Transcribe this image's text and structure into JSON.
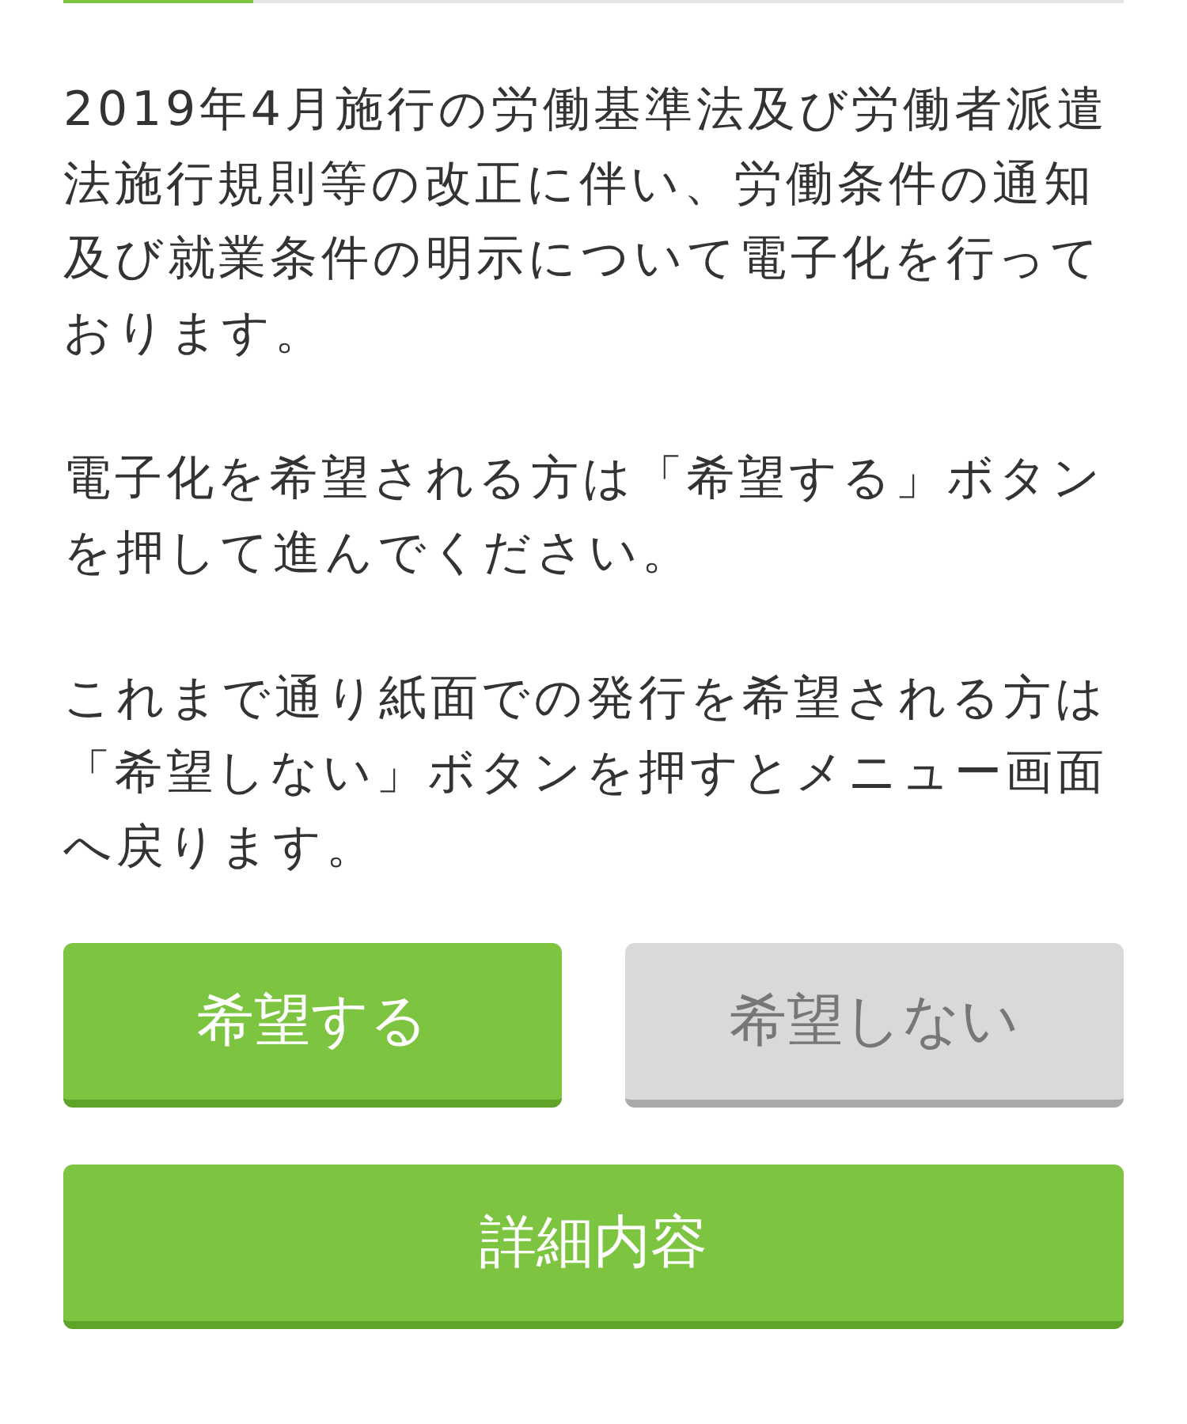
{
  "tab_bar": {
    "tabs": [
      {
        "selected": true
      },
      {
        "selected": false
      }
    ]
  },
  "paragraphs": [
    "2019年4月施行の労働基準法及び労働者派遣法施行規則等の改正に伴い、労働条件の通知及び就業条件の明示について電子化を行っております。",
    "電子化を希望される方は「希望する」ボタンを押して進んでください。",
    "これまで通り紙面での発行を希望される方は「希望しない」ボタンを押すとメニュー画面へ戻ります。"
  ],
  "choice_buttons": [
    {
      "label": "希望する",
      "kind": "primary"
    },
    {
      "label": "希望しない",
      "kind": "secondary"
    }
  ],
  "detail_button": {
    "label": "詳細内容",
    "kind": "primary"
  }
}
